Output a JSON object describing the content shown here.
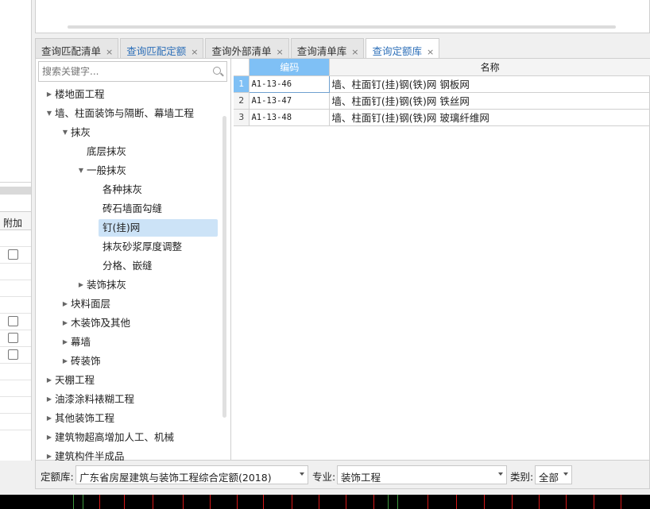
{
  "left_panel": {
    "header": "附加"
  },
  "tabs": [
    {
      "label": "查询匹配清单",
      "state": "normal"
    },
    {
      "label": "查询匹配定额",
      "state": "highlight"
    },
    {
      "label": "查询外部清单",
      "state": "normal"
    },
    {
      "label": "查询清单库",
      "state": "normal"
    },
    {
      "label": "查询定额库",
      "state": "active"
    }
  ],
  "tab_close": "×",
  "search": {
    "placeholder": "搜索关键字..."
  },
  "tree": [
    {
      "label": "楼地面工程",
      "depth": 0,
      "arrow": "right"
    },
    {
      "label": "墙、柱面装饰与隔断、幕墙工程",
      "depth": 0,
      "arrow": "down"
    },
    {
      "label": "抹灰",
      "depth": 1,
      "arrow": "down"
    },
    {
      "label": "底层抹灰",
      "depth": 2,
      "arrow": "none"
    },
    {
      "label": "一般抹灰",
      "depth": 2,
      "arrow": "down"
    },
    {
      "label": "各种抹灰",
      "depth": 3,
      "arrow": "none"
    },
    {
      "label": "砖石墙面勾缝",
      "depth": 3,
      "arrow": "none"
    },
    {
      "label": "钉(挂)网",
      "depth": 3,
      "arrow": "none",
      "selected": true
    },
    {
      "label": "抹灰砂浆厚度调整",
      "depth": 3,
      "arrow": "none"
    },
    {
      "label": "分格、嵌缝",
      "depth": 3,
      "arrow": "none"
    },
    {
      "label": "装饰抹灰",
      "depth": 2,
      "arrow": "right"
    },
    {
      "label": "块料面层",
      "depth": 1,
      "arrow": "right"
    },
    {
      "label": "木装饰及其他",
      "depth": 1,
      "arrow": "right"
    },
    {
      "label": "幕墙",
      "depth": 1,
      "arrow": "right"
    },
    {
      "label": "砖装饰",
      "depth": 1,
      "arrow": "right"
    },
    {
      "label": "天棚工程",
      "depth": 0,
      "arrow": "right"
    },
    {
      "label": "油漆涂料裱糊工程",
      "depth": 0,
      "arrow": "right"
    },
    {
      "label": "其他装饰工程",
      "depth": 0,
      "arrow": "right"
    },
    {
      "label": "建筑物超高增加人工、机械",
      "depth": 0,
      "arrow": "right"
    },
    {
      "label": "建筑构件半成品",
      "depth": 0,
      "arrow": "right"
    }
  ],
  "grid": {
    "columns": [
      "编码",
      "名称"
    ],
    "rows": [
      {
        "num": "1",
        "code": "A1-13-46",
        "name": "墙、柱面钉(挂)钢(铁)网 钢板网"
      },
      {
        "num": "2",
        "code": "A1-13-47",
        "name": "墙、柱面钉(挂)钢(铁)网 铁丝网"
      },
      {
        "num": "3",
        "code": "A1-13-48",
        "name": "墙、柱面钉(挂)钢(铁)网 玻璃纤维网"
      }
    ]
  },
  "bottom": {
    "quota_label": "定额库:",
    "quota_value": "广东省房屋建筑与装饰工程综合定额(2018)",
    "major_label": "专业:",
    "major_value": "装饰工程",
    "category_label": "类别:",
    "category_value": "全部"
  },
  "colors": {
    "accent": "#2d6fb8",
    "selected_bg": "#cce3f7",
    "header_blue": "#7fc0f5"
  }
}
